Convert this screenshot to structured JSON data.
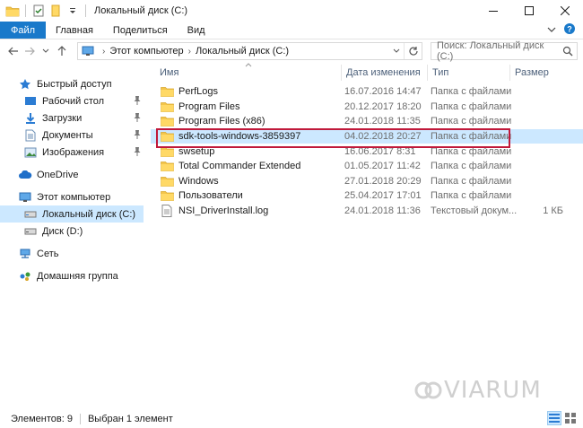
{
  "window": {
    "title": "Локальный диск (C:)",
    "minimize_glyph": "—",
    "maximize_glyph": "☐",
    "close_glyph": "✕"
  },
  "ribbon": {
    "tabs": [
      "Файл",
      "Главная",
      "Поделиться",
      "Вид"
    ],
    "accent": "#1979ca"
  },
  "address": {
    "crumbs": [
      "Этот компьютер",
      "Локальный диск (C:)"
    ],
    "separator": "›"
  },
  "search": {
    "placeholder": "Поиск: Локальный диск (C:)"
  },
  "nav": {
    "items": [
      {
        "label": "Быстрый доступ",
        "icon": "star-icon",
        "level": 1,
        "pinned": false
      },
      {
        "label": "Рабочий стол",
        "icon": "desktop-icon",
        "level": 2,
        "pinned": true
      },
      {
        "label": "Загрузки",
        "icon": "downloads-icon",
        "level": 2,
        "pinned": true
      },
      {
        "label": "Документы",
        "icon": "documents-icon",
        "level": 2,
        "pinned": true
      },
      {
        "label": "Изображения",
        "icon": "pictures-icon",
        "level": 2,
        "pinned": true
      },
      {
        "label": "OneDrive",
        "icon": "cloud-icon",
        "level": 1,
        "pinned": false
      },
      {
        "label": "Этот компьютер",
        "icon": "computer-icon",
        "level": 1,
        "pinned": false
      },
      {
        "label": "Локальный диск (C:)",
        "icon": "drive-icon",
        "level": 2,
        "pinned": false,
        "selected": true
      },
      {
        "label": "Диск (D:)",
        "icon": "drive-icon",
        "level": 2,
        "pinned": false
      },
      {
        "label": "Сеть",
        "icon": "network-icon",
        "level": 1,
        "pinned": false
      },
      {
        "label": "Домашняя группа",
        "icon": "homegroup-icon",
        "level": 1,
        "pinned": false
      }
    ]
  },
  "columns": {
    "name": "Имя",
    "date": "Дата изменения",
    "type": "Тип",
    "size": "Размер"
  },
  "files": [
    {
      "name": "PerfLogs",
      "date": "16.07.2016 14:47",
      "type": "Папка с файлами",
      "size": "",
      "icon": "folder-icon"
    },
    {
      "name": "Program Files",
      "date": "20.12.2017 18:20",
      "type": "Папка с файлами",
      "size": "",
      "icon": "folder-icon"
    },
    {
      "name": "Program Files (x86)",
      "date": "24.01.2018 11:35",
      "type": "Папка с файлами",
      "size": "",
      "icon": "folder-icon"
    },
    {
      "name": "sdk-tools-windows-3859397",
      "date": "04.02.2018 20:27",
      "type": "Папка с файлами",
      "size": "",
      "icon": "folder-icon",
      "selected": true
    },
    {
      "name": "swsetup",
      "date": "16.06.2017 8:31",
      "type": "Папка с файлами",
      "size": "",
      "icon": "folder-icon"
    },
    {
      "name": "Total Commander Extended",
      "date": "01.05.2017 11:42",
      "type": "Папка с файлами",
      "size": "",
      "icon": "folder-icon"
    },
    {
      "name": "Windows",
      "date": "27.01.2018 20:29",
      "type": "Папка с файлами",
      "size": "",
      "icon": "folder-icon"
    },
    {
      "name": "Пользователи",
      "date": "25.04.2017 17:01",
      "type": "Папка с файлами",
      "size": "",
      "icon": "folder-icon"
    },
    {
      "name": "NSI_DriverInstall.log",
      "date": "24.01.2018 11:36",
      "type": "Текстовый докум...",
      "size": "1 КБ",
      "icon": "text-file-icon"
    }
  ],
  "status": {
    "count": "Элементов: 9",
    "selection": "Выбран 1 элемент"
  },
  "watermark": "VIARUM",
  "colors": {
    "selection": "#cce8ff",
    "highlight_border": "#c0193a",
    "folder": "#f3c54a"
  }
}
